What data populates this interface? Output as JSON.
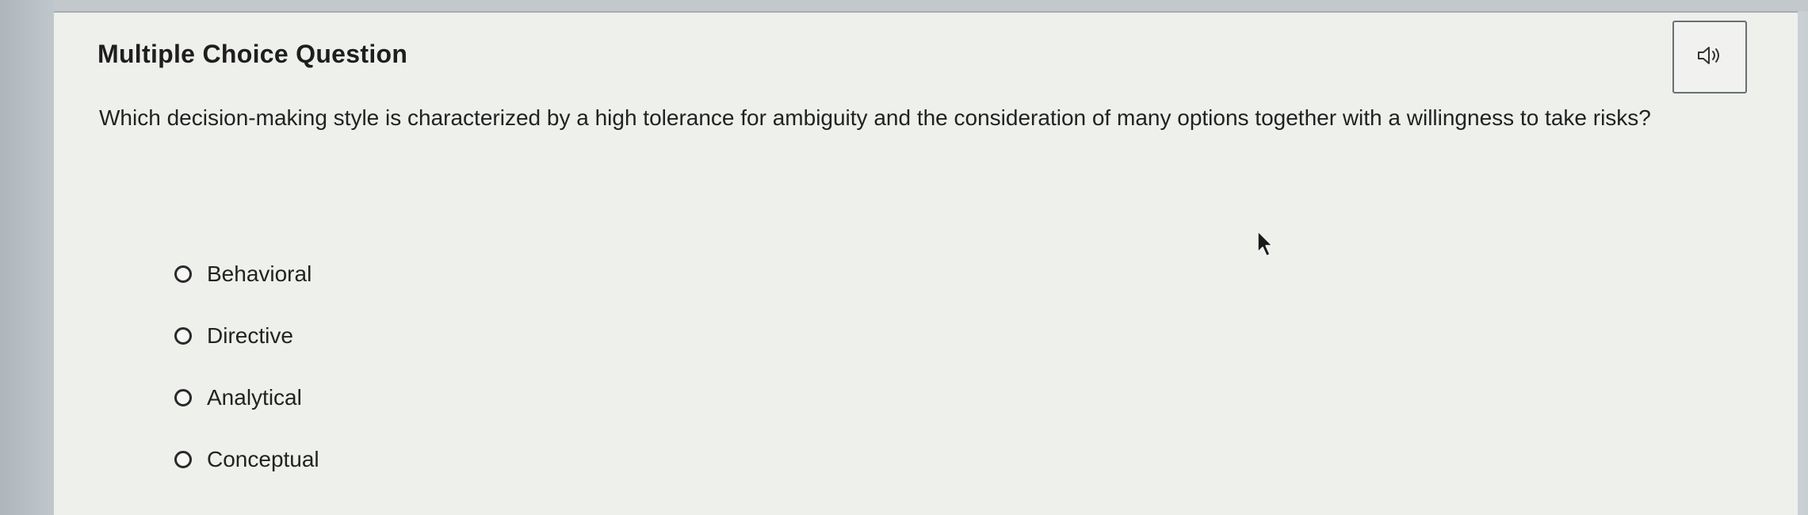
{
  "question_card": {
    "title": "Multiple Choice Question",
    "audio_icon": "speaker-icon",
    "question_text": "Which decision-making style is characterized by a high tolerance for ambiguity and the consideration of many options together with a willingness to take risks?",
    "options": [
      {
        "label": "Behavioral",
        "selected": false
      },
      {
        "label": "Directive",
        "selected": false
      },
      {
        "label": "Analytical",
        "selected": false
      },
      {
        "label": "Conceptual",
        "selected": false
      }
    ]
  },
  "cursor_icon": "mouse-pointer-icon"
}
